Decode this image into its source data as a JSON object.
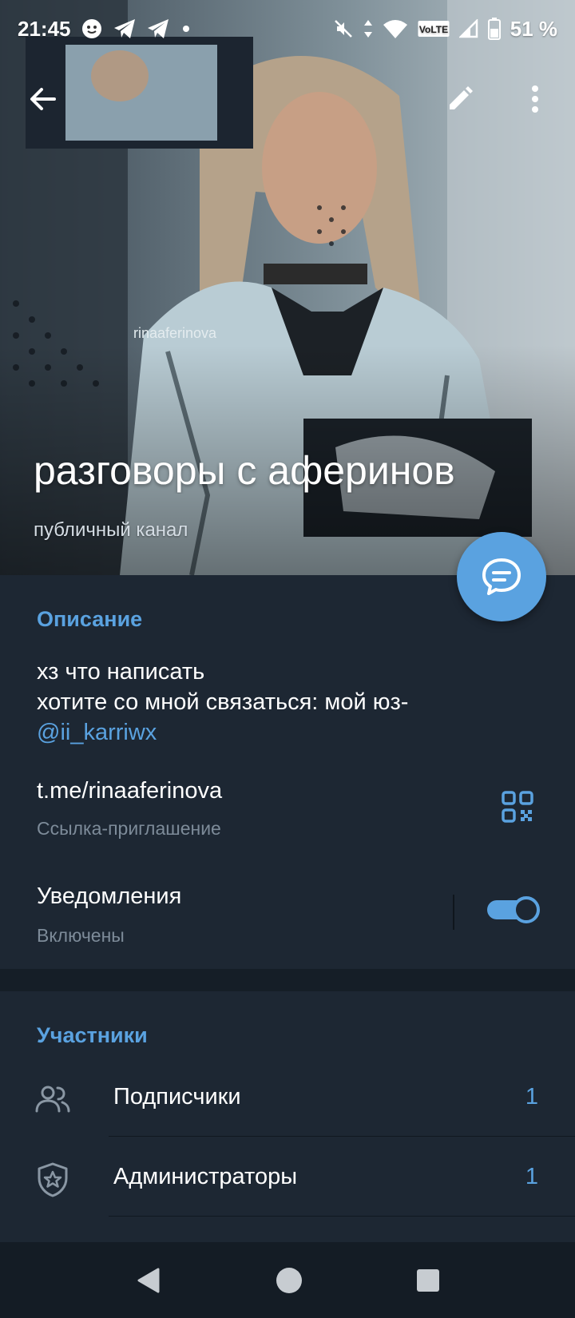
{
  "status_bar": {
    "time": "21:45",
    "network": "VoLTE",
    "battery": "51 %"
  },
  "header": {
    "title": "разговоры с аферинов",
    "subtitle": "публичный канал",
    "watermark": "rinaaferinova"
  },
  "description": {
    "section_title": "Описание",
    "line1": "хз что написать",
    "line2": "хотите со мной связаться: мой юз-",
    "mention": "@ii_karriwx"
  },
  "link": {
    "value": "t.me/rinaaferinova",
    "caption": "Ссылка-приглашение"
  },
  "notifications": {
    "label": "Уведомления",
    "state": "Включены",
    "enabled": true
  },
  "members": {
    "section_title": "Участники",
    "items": [
      {
        "label": "Подписчики",
        "count": "1",
        "icon": "people-icon"
      },
      {
        "label": "Администраторы",
        "count": "1",
        "icon": "shield-star-icon"
      }
    ]
  },
  "colors": {
    "accent": "#5aa2e0",
    "background": "#1d2733",
    "secondary_text": "#7d8b99"
  }
}
